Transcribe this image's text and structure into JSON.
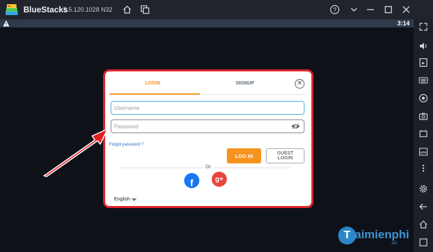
{
  "window": {
    "app_name": "BlueStacks",
    "version": "5.5.120.1028 N32",
    "controls": [
      "help-icon",
      "minimize-icon",
      "maximize-icon",
      "close-icon"
    ],
    "toolbar_icons": [
      "home-icon",
      "multi-instance-icon"
    ]
  },
  "statusbar": {
    "time": "3:14"
  },
  "sidebar": {
    "icons": [
      "expand-icon",
      "volume-icon",
      "screen-rotate-icon",
      "keyboard-icon",
      "record-icon",
      "camera-icon",
      "apk-icon",
      "more-icon",
      "settings-icon",
      "back-icon",
      "home-icon",
      "recent-apps-icon"
    ]
  },
  "dialog": {
    "tab_login": "LOGIN",
    "tab_signup": "SIGNUP",
    "username_placeholder": "Username",
    "password_placeholder": "Password",
    "forgot": "Forgot password ?",
    "login_button": "LOG IN",
    "guest_button": "GUEST LOGIN",
    "or_label": "Or",
    "facebook_label": "f",
    "google_label": "g+",
    "language": "English"
  },
  "watermark": {
    "brand": "aimienphi",
    "letter": "T",
    "suffix": ".vn"
  },
  "colors": {
    "accent": "#f5931e",
    "highlight_border": "#e0232f",
    "facebook": "#1877f2",
    "google": "#e8453c"
  }
}
